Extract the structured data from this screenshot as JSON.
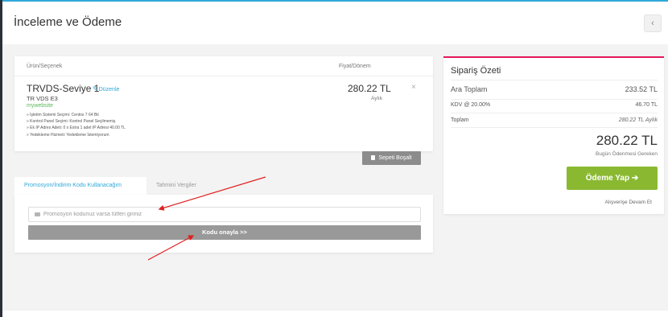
{
  "header": {
    "title": "İnceleme ve Ödeme",
    "back_icon": "‹"
  },
  "cart": {
    "columns": {
      "product": "Ürün/Seçenek",
      "price": "Fiyat/Dönem"
    },
    "item": {
      "name": "TRVDS-Seviye 1",
      "edit_label": "Düzenle",
      "subtitle": "TR VDS E3",
      "domain": "mywebsite",
      "config": [
        "» İşletim Sistemi Seçimi: Centos 7 64 Bit",
        "» Kontrol Panel Seçimi: Kontrol Panel Seçilmemiş",
        "» Ek IP Adres Adeti: 0 x Extra 1 adet IP Adresi 40.00 TL",
        "» Yedekleme Hizmeti: Yedekleme İstemiyorum"
      ],
      "price": "280.22 TL",
      "cycle": "Aylık",
      "remove_icon": "×"
    },
    "empty_label": "Sepeti Boşalt"
  },
  "promo": {
    "tabs": [
      "Promosyon/İndirim Kodu Kullanacağım",
      "Tahmini Vergiler"
    ],
    "placeholder": "Promosyon kodunuz varsa lütfen giriniz",
    "validate_label": "Kodu onayla >>"
  },
  "summary": {
    "title": "Sipariş Özeti",
    "subtotal_label": "Ara Toplam",
    "subtotal_value": "233.52 TL",
    "tax_label": "KDV @ 20.00%",
    "tax_value": "46.70 TL",
    "total_label": "Toplam",
    "total_value": "280.22 TL Aylık",
    "total_big": "280.22 TL",
    "due_today": "Bugün Ödenmesi Gereken",
    "checkout_label": "Ödeme Yap ➔",
    "continue_label": "Alışverişe Devam Et"
  },
  "colors": {
    "accent_blue": "#2fa8d8",
    "accent_pink": "#e2185b",
    "checkout_green": "#8ab931",
    "annotation_red": "#e02020"
  }
}
